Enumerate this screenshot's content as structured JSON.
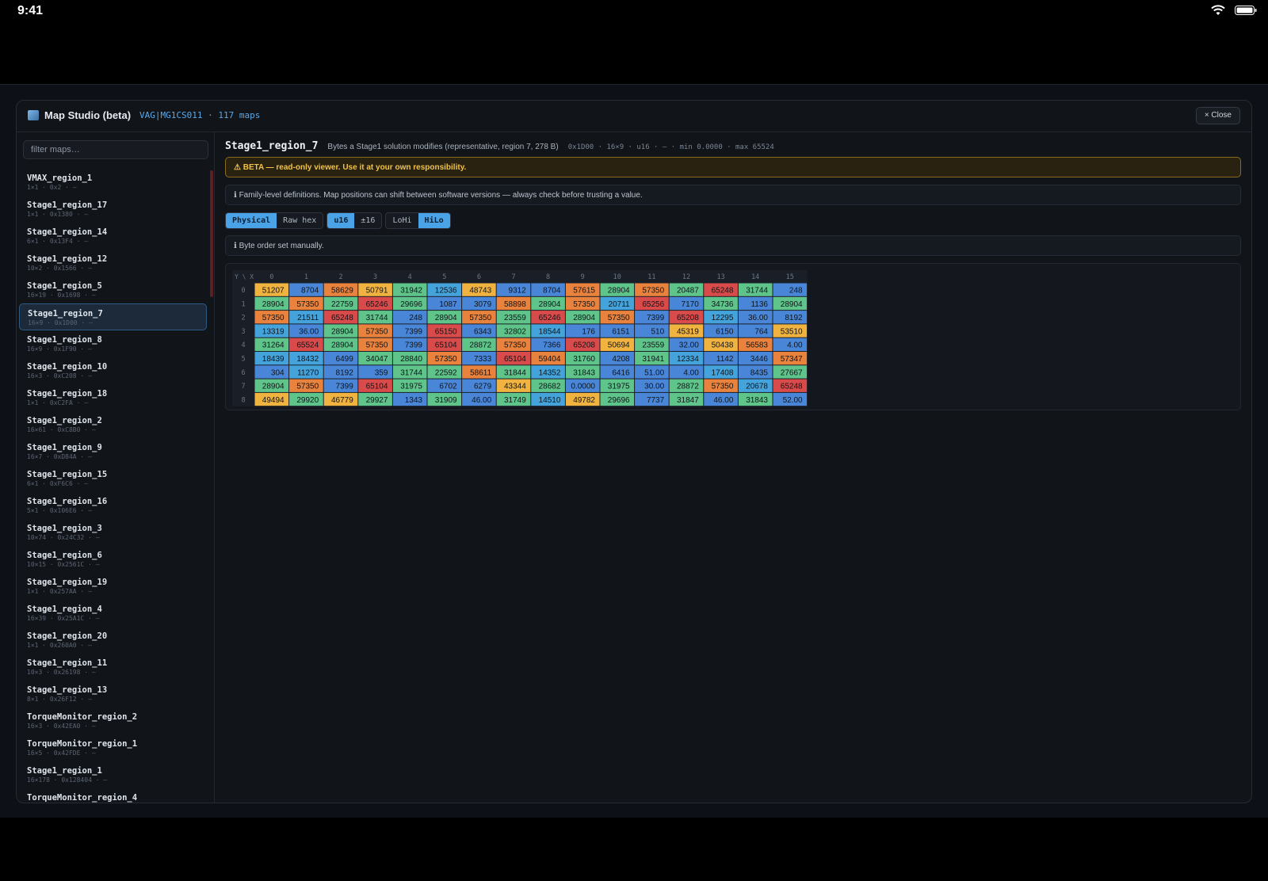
{
  "status": {
    "time": "9:41"
  },
  "modal": {
    "title": "Map Studio (beta)",
    "subtitle": "VAG|MG1CS011 · 117 maps",
    "close_label": "× Close"
  },
  "sidebar": {
    "filter_placeholder": "filter maps…",
    "items": [
      {
        "name": "VMAX_region_1",
        "meta": "1×1 · 0x2 · —"
      },
      {
        "name": "Stage1_region_17",
        "meta": "1×1 · 0x1380 · —"
      },
      {
        "name": "Stage1_region_14",
        "meta": "6×1 · 0x13F4 · —"
      },
      {
        "name": "Stage1_region_12",
        "meta": "10×2 · 0x1566 · —"
      },
      {
        "name": "Stage1_region_5",
        "meta": "16×19 · 0x1698 · —"
      },
      {
        "name": "Stage1_region_7",
        "meta": "16×9 · 0x1D00 · —",
        "active": true
      },
      {
        "name": "Stage1_region_8",
        "meta": "16×9 · 0x1F90 · —"
      },
      {
        "name": "Stage1_region_10",
        "meta": "16×3 · 0xC208 · —"
      },
      {
        "name": "Stage1_region_18",
        "meta": "1×1 · 0xC2FA · —"
      },
      {
        "name": "Stage1_region_2",
        "meta": "16×61 · 0xC8B0 · —"
      },
      {
        "name": "Stage1_region_9",
        "meta": "16×7 · 0xD84A · —"
      },
      {
        "name": "Stage1_region_15",
        "meta": "6×1 · 0xF6C6 · —"
      },
      {
        "name": "Stage1_region_16",
        "meta": "5×1 · 0x106E6 · —"
      },
      {
        "name": "Stage1_region_3",
        "meta": "10×74 · 0x24C32 · —"
      },
      {
        "name": "Stage1_region_6",
        "meta": "10×15 · 0x2561C · —"
      },
      {
        "name": "Stage1_region_19",
        "meta": "1×1 · 0x257AA · —"
      },
      {
        "name": "Stage1_region_4",
        "meta": "16×39 · 0x25A1C · —"
      },
      {
        "name": "Stage1_region_20",
        "meta": "1×1 · 0x260A0 · —"
      },
      {
        "name": "Stage1_region_11",
        "meta": "10×3 · 0x26198 · —"
      },
      {
        "name": "Stage1_region_13",
        "meta": "8×1 · 0x26F12 · —"
      },
      {
        "name": "TorqueMonitor_region_2",
        "meta": "16×3 · 0x42EA0 · —"
      },
      {
        "name": "TorqueMonitor_region_1",
        "meta": "16×5 · 0x42FDE · —"
      },
      {
        "name": "Stage1_region_1",
        "meta": "16×178 · 0x128404 · —"
      },
      {
        "name": "TorqueMonitor_region_4",
        "meta": ""
      }
    ]
  },
  "main": {
    "map_name": "Stage1_region_7",
    "map_desc": "Bytes a Stage1 solution modifies (representative, region 7, 278 B)",
    "map_meta": "0x1D00 · 16×9 · u16 · — · min 0.0000 · max 65524",
    "beta_warning": "⚠ BETA — read-only viewer. Use it at your own responsibility.",
    "family_note": "ℹ Family-level definitions. Map positions can shift between software versions — always check before trusting a value.",
    "byte_order_note": "ℹ Byte order set manually.",
    "toggles": {
      "view": [
        {
          "label": "Physical",
          "on": true
        },
        {
          "label": "Raw hex",
          "on": false
        }
      ],
      "type": [
        {
          "label": "u16",
          "on": true
        },
        {
          "label": "±16",
          "on": false
        }
      ],
      "order": [
        {
          "label": "LoHi",
          "on": false
        },
        {
          "label": "HiLo",
          "on": true
        }
      ]
    }
  },
  "grid": {
    "corner_label": "Y \\ X",
    "x_labels": [
      "0",
      "1",
      "2",
      "3",
      "4",
      "5",
      "6",
      "7",
      "8",
      "9",
      "10",
      "11",
      "12",
      "13",
      "14",
      "15"
    ],
    "y_labels": [
      "0",
      "1",
      "2",
      "3",
      "4",
      "5",
      "6",
      "7",
      "8"
    ],
    "cells": [
      [
        "51207",
        "8704",
        "58629",
        "50791",
        "31942",
        "12536",
        "48743",
        "9312",
        "8704",
        "57615",
        "28904",
        "57350",
        "20487",
        "65248",
        "31744",
        "248"
      ],
      [
        "28904",
        "57350",
        "22759",
        "65246",
        "29696",
        "1087",
        "3079",
        "58898",
        "28904",
        "57350",
        "20711",
        "65256",
        "7170",
        "34736",
        "1136",
        "28904"
      ],
      [
        "57350",
        "21511",
        "65248",
        "31744",
        "248",
        "28904",
        "57350",
        "23559",
        "65246",
        "28904",
        "57350",
        "7399",
        "65208",
        "12295",
        "36.00",
        "8192"
      ],
      [
        "13319",
        "36.00",
        "28904",
        "57350",
        "7399",
        "65150",
        "6343",
        "32802",
        "18544",
        "176",
        "6151",
        "510",
        "45319",
        "6150",
        "764",
        "53510"
      ],
      [
        "31264",
        "65524",
        "28904",
        "57350",
        "7399",
        "65104",
        "28872",
        "57350",
        "7366",
        "65208",
        "50694",
        "23559",
        "32.00",
        "50438",
        "56583",
        "4.00"
      ],
      [
        "18439",
        "18432",
        "6499",
        "34047",
        "28840",
        "57350",
        "7333",
        "65104",
        "59404",
        "31760",
        "4208",
        "31941",
        "12334",
        "1142",
        "3446",
        "57347"
      ],
      [
        "304",
        "11270",
        "8192",
        "359",
        "31744",
        "22592",
        "58611",
        "31844",
        "14352",
        "31843",
        "6416",
        "51.00",
        "4.00",
        "17408",
        "8435",
        "27667"
      ],
      [
        "28904",
        "57350",
        "7399",
        "65104",
        "31975",
        "6702",
        "6279",
        "43344",
        "28682",
        "0.0000",
        "31975",
        "30.00",
        "28872",
        "57350",
        "20678",
        "65248"
      ],
      [
        "49494",
        "29920",
        "46779",
        "29927",
        "1343",
        "31909",
        "46.00",
        "31749",
        "14510",
        "49782",
        "29696",
        "7737",
        "31847",
        "46.00",
        "31843",
        "52.00"
      ]
    ],
    "colors": [
      [
        "#f0b340",
        "#4a86d8",
        "#e8823c",
        "#f0b340",
        "#5ec48a",
        "#45a3dc",
        "#f0b340",
        "#4a86d8",
        "#4a86d8",
        "#e8823c",
        "#5ec48a",
        "#e8823c",
        "#5ec48a",
        "#d94a4a",
        "#5ec48a",
        "#4a86d8"
      ],
      [
        "#5ec48a",
        "#e8823c",
        "#5ec48a",
        "#d94a4a",
        "#5ec48a",
        "#4a86d8",
        "#4a86d8",
        "#e8823c",
        "#5ec48a",
        "#e8823c",
        "#45a3dc",
        "#d94a4a",
        "#4a86d8",
        "#5ec48a",
        "#4a86d8",
        "#5ec48a"
      ],
      [
        "#e8823c",
        "#45a3dc",
        "#d94a4a",
        "#5ec48a",
        "#4a86d8",
        "#5ec48a",
        "#e8823c",
        "#5ec48a",
        "#d94a4a",
        "#5ec48a",
        "#e8823c",
        "#4a86d8",
        "#d94a4a",
        "#45a3dc",
        "#4a86d8",
        "#4a86d8"
      ],
      [
        "#45a3dc",
        "#4a86d8",
        "#5ec48a",
        "#e8823c",
        "#4a86d8",
        "#d94a4a",
        "#4a86d8",
        "#5ec48a",
        "#45a3dc",
        "#4a86d8",
        "#4a86d8",
        "#4a86d8",
        "#f0b340",
        "#4a86d8",
        "#4a86d8",
        "#f0b340"
      ],
      [
        "#5ec48a",
        "#d94a4a",
        "#5ec48a",
        "#e8823c",
        "#4a86d8",
        "#d94a4a",
        "#5ec48a",
        "#e8823c",
        "#4a86d8",
        "#d94a4a",
        "#f0b340",
        "#5ec48a",
        "#4a86d8",
        "#f0b340",
        "#e8823c",
        "#4a86d8"
      ],
      [
        "#45a3dc",
        "#45a3dc",
        "#4a86d8",
        "#5ec48a",
        "#5ec48a",
        "#e8823c",
        "#4a86d8",
        "#d94a4a",
        "#e8823c",
        "#5ec48a",
        "#4a86d8",
        "#5ec48a",
        "#45a3dc",
        "#4a86d8",
        "#4a86d8",
        "#e8823c"
      ],
      [
        "#4a86d8",
        "#45a3dc",
        "#4a86d8",
        "#4a86d8",
        "#5ec48a",
        "#5ec48a",
        "#e8823c",
        "#5ec48a",
        "#45a3dc",
        "#5ec48a",
        "#4a86d8",
        "#4a86d8",
        "#4a86d8",
        "#45a3dc",
        "#4a86d8",
        "#5ec48a"
      ],
      [
        "#5ec48a",
        "#e8823c",
        "#4a86d8",
        "#d94a4a",
        "#5ec48a",
        "#4a86d8",
        "#4a86d8",
        "#f0b340",
        "#5ec48a",
        "#4a86d8",
        "#5ec48a",
        "#4a86d8",
        "#5ec48a",
        "#e8823c",
        "#45a3dc",
        "#d94a4a"
      ],
      [
        "#f0b340",
        "#5ec48a",
        "#f0b340",
        "#5ec48a",
        "#4a86d8",
        "#5ec48a",
        "#4a86d8",
        "#5ec48a",
        "#45a3dc",
        "#f0b340",
        "#5ec48a",
        "#4a86d8",
        "#5ec48a",
        "#4a86d8",
        "#5ec48a",
        "#4a86d8"
      ]
    ]
  }
}
